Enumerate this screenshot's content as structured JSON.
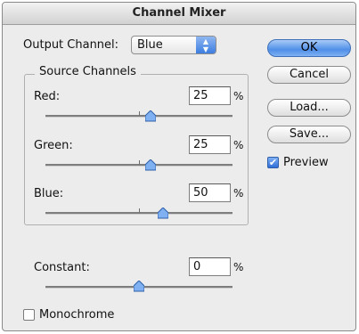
{
  "window": {
    "title": "Channel Mixer"
  },
  "output_channel": {
    "label": "Output Channel:",
    "value": "Blue"
  },
  "source_channels": {
    "legend": "Source Channels",
    "red": {
      "label": "Red:",
      "value": "25",
      "unit": "%"
    },
    "green": {
      "label": "Green:",
      "value": "25",
      "unit": "%"
    },
    "blue": {
      "label": "Blue:",
      "value": "50",
      "unit": "%"
    }
  },
  "constant": {
    "label": "Constant:",
    "value": "0",
    "unit": "%"
  },
  "monochrome": {
    "label": "Monochrome",
    "checked": false
  },
  "buttons": {
    "ok": "OK",
    "cancel": "Cancel",
    "load": "Load...",
    "save": "Save..."
  },
  "preview": {
    "label": "Preview",
    "checked": true
  },
  "colors": {
    "accent_blue": "#4f8fe8",
    "window_bg": "#ececec"
  }
}
